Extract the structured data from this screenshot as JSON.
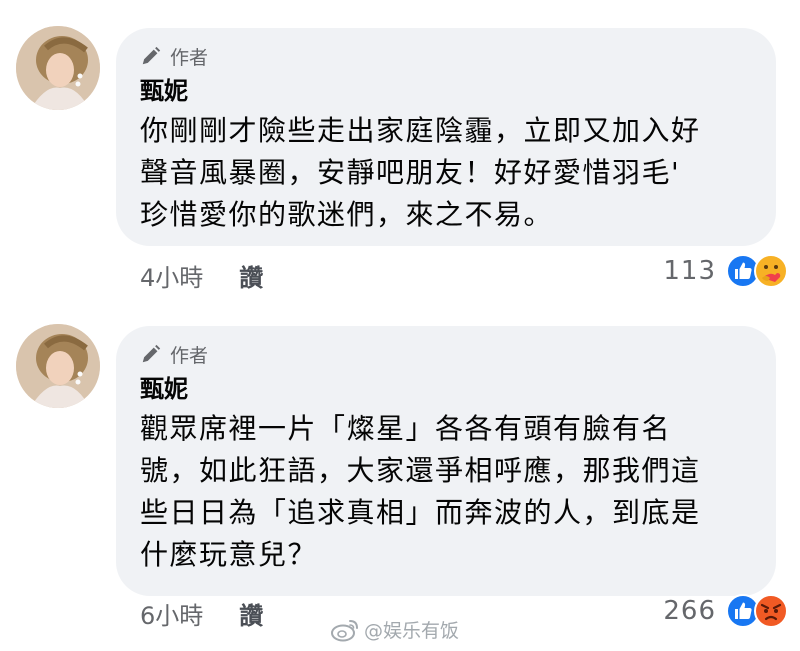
{
  "comments": [
    {
      "author_badge": "作者",
      "name": "甄妮",
      "text": "你剛剛才險些走出家庭陰霾，立即又加入好\n聲音風暴圈，安靜吧朋友！好好愛惜羽毛'\n珍惜愛你的歌迷們，來之不易。",
      "time": "4小時",
      "like_label": "讚",
      "reaction_count": "113",
      "reactions": [
        "like-icon",
        "care-icon"
      ]
    },
    {
      "author_badge": "作者",
      "name": "甄妮",
      "text": "觀眾席裡一片「燦星」各各有頭有臉有名\n號，如此狂語，大家還爭相呼應，那我們這\n些日日為「追求真相」而奔波的人，到底是\n什麼玩意兒？",
      "time": "6小時",
      "like_label": "讚",
      "reaction_count": "266",
      "reactions": [
        "like-icon",
        "angry-icon"
      ]
    }
  ],
  "watermark": {
    "text": "@娱乐有饭",
    "icon": "weibo-icon"
  },
  "colors": {
    "bubble": "#f0f2f5",
    "like_blue": "#1877f2",
    "meta_gray": "#65676b",
    "angry_orange": "#f15a24"
  }
}
